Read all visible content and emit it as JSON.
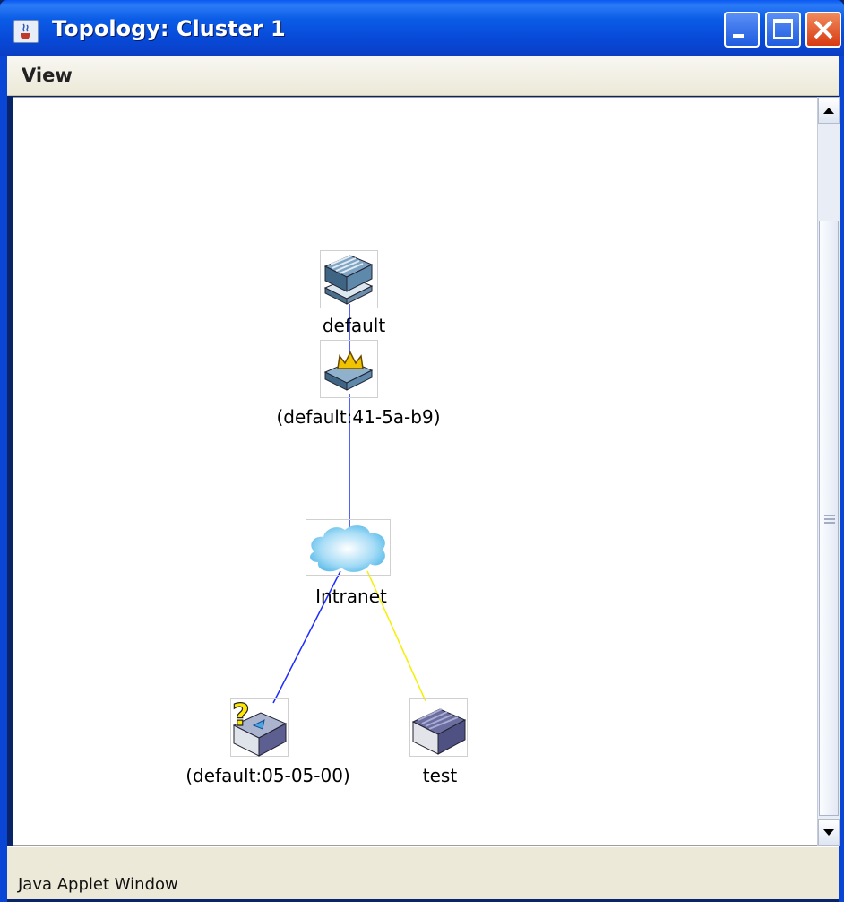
{
  "window": {
    "title": "Topology: Cluster 1"
  },
  "menu": {
    "view_label": "View"
  },
  "topology": {
    "nodes": [
      {
        "id": "default",
        "label": "default",
        "type": "group-switch"
      },
      {
        "id": "commander",
        "label": "(default:41-5a-b9)",
        "type": "commander-switch"
      },
      {
        "id": "intranet",
        "label": "Intranet",
        "type": "cloud"
      },
      {
        "id": "candidate",
        "label": "(default:05-05-00)",
        "type": "unknown-switch"
      },
      {
        "id": "test",
        "label": "test",
        "type": "switch"
      }
    ],
    "links": [
      {
        "from": "default",
        "to": "commander",
        "color": "#1f2bff"
      },
      {
        "from": "commander",
        "to": "intranet",
        "color": "#1f2bff"
      },
      {
        "from": "intranet",
        "to": "candidate",
        "color": "#1f2bff"
      },
      {
        "from": "intranet",
        "to": "test",
        "color": "#f4f000"
      }
    ]
  },
  "status": {
    "text": "Java Applet Window"
  },
  "colors": {
    "titlebar": "#0a58f2",
    "close": "#d83a12",
    "link_blue": "#1f2bff",
    "link_yellow": "#f4f000"
  }
}
